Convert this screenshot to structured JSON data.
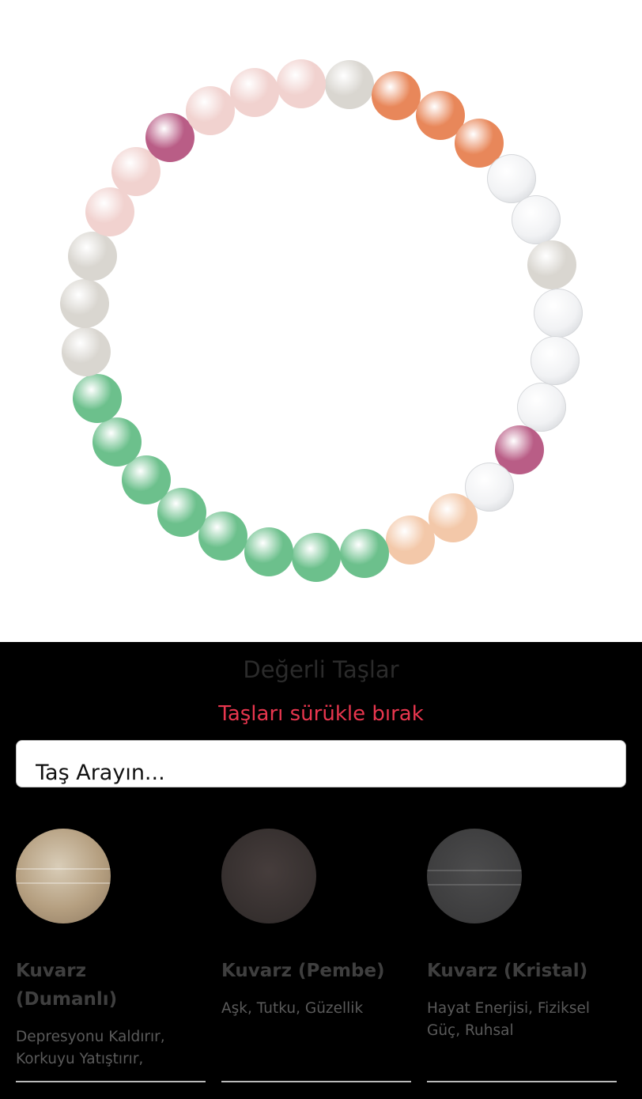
{
  "bracelet": {
    "beads": [
      "moonstone",
      "carnelian",
      "carnelian",
      "carnelian",
      "crystal",
      "crystal",
      "moonstone",
      "crystal",
      "crystal",
      "crystal",
      "ruby",
      "crystal",
      "peach",
      "peach",
      "aventurine",
      "aventurine",
      "aventurine",
      "aventurine",
      "aventurine",
      "aventurine",
      "aventurine",
      "aventurine",
      "moonstone",
      "moonstone",
      "moonstone",
      "rose",
      "rose",
      "ruby",
      "rose",
      "rose",
      "rose"
    ],
    "colors": {
      "moonstone": "#d9d6d0",
      "carnelian": "#e8875a",
      "crystal": "#eef0f2",
      "ruby": "#b95d86",
      "peach": "#f3c8a9",
      "aventurine": "#6cc08c",
      "rose": "#f1d2cf"
    }
  },
  "panel": {
    "title": "Değerli Taşlar",
    "subtitle": "Taşları sürükle bırak",
    "search_placeholder": "Taş Arayın..."
  },
  "stones": [
    {
      "name": "Kuvarz (Dumanlı)",
      "description": "Depresyonu Kaldırır, Korkuyu Yatıştırır,",
      "color": "#b9a88e"
    },
    {
      "name": "Kuvarz (Pembe)",
      "description": "Aşk, Tutku, Güzellik",
      "color": "#3a3433"
    },
    {
      "name": "Kuvarz (Kristal)",
      "description": "Hayat Enerjisi, Fiziksel Güç, Ruhsal",
      "color": "#3f3f40"
    }
  ]
}
